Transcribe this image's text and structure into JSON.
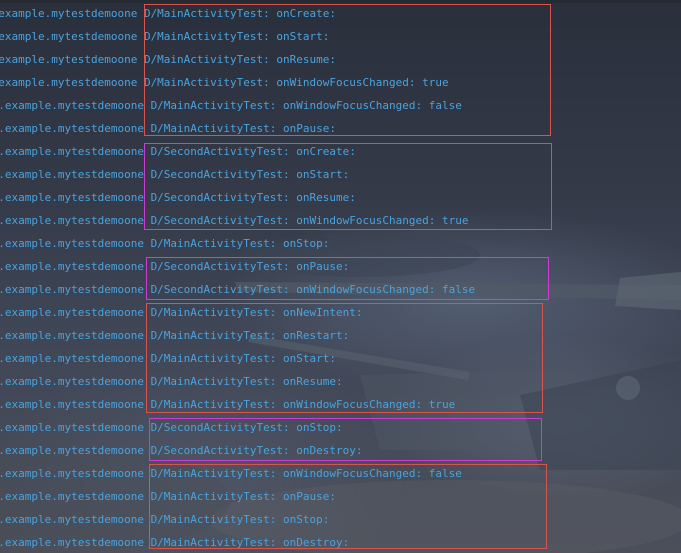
{
  "console": {
    "lines": [
      "m.example.mytestdemoone D/MainActivityTest: onCreate:",
      "m.example.mytestdemoone D/MainActivityTest: onStart:",
      "m.example.mytestdemoone D/MainActivityTest: onResume:",
      "m.example.mytestdemoone D/MainActivityTest: onWindowFocusChanged: true",
      "om.example.mytestdemoone D/MainActivityTest: onWindowFocusChanged: false",
      "om.example.mytestdemoone D/MainActivityTest: onPause:",
      "om.example.mytestdemoone D/SecondActivityTest: onCreate:",
      "om.example.mytestdemoone D/SecondActivityTest: onStart:",
      "om.example.mytestdemoone D/SecondActivityTest: onResume:",
      "om.example.mytestdemoone D/SecondActivityTest: onWindowFocusChanged: true",
      "om.example.mytestdemoone D/MainActivityTest: onStop:",
      "om.example.mytestdemoone D/SecondActivityTest: onPause:",
      "om.example.mytestdemoone D/SecondActivityTest: onWindowFocusChanged: false",
      "om.example.mytestdemoone D/MainActivityTest: onNewIntent:",
      "om.example.mytestdemoone D/MainActivityTest: onRestart:",
      "om.example.mytestdemoone D/MainActivityTest: onStart:",
      "om.example.mytestdemoone D/MainActivityTest: onResume:",
      "om.example.mytestdemoone D/MainActivityTest: onWindowFocusChanged: true",
      "om.example.mytestdemoone D/SecondActivityTest: onStop:",
      "om.example.mytestdemoone D/SecondActivityTest: onDestroy:",
      "om.example.mytestdemoone D/MainActivityTest: onWindowFocusChanged: false",
      "om.example.mytestdemoone D/MainActivityTest: onPause:",
      "om.example.mytestdemoone D/MainActivityTest: onStop:",
      "om.example.mytestdemoone D/MainActivityTest: onDestroy:"
    ]
  },
  "colors": {
    "log_text": "#4aa3df",
    "highlight_red": "#d9534f",
    "highlight_magenta": "#d23ad6",
    "background": "#343a48"
  }
}
